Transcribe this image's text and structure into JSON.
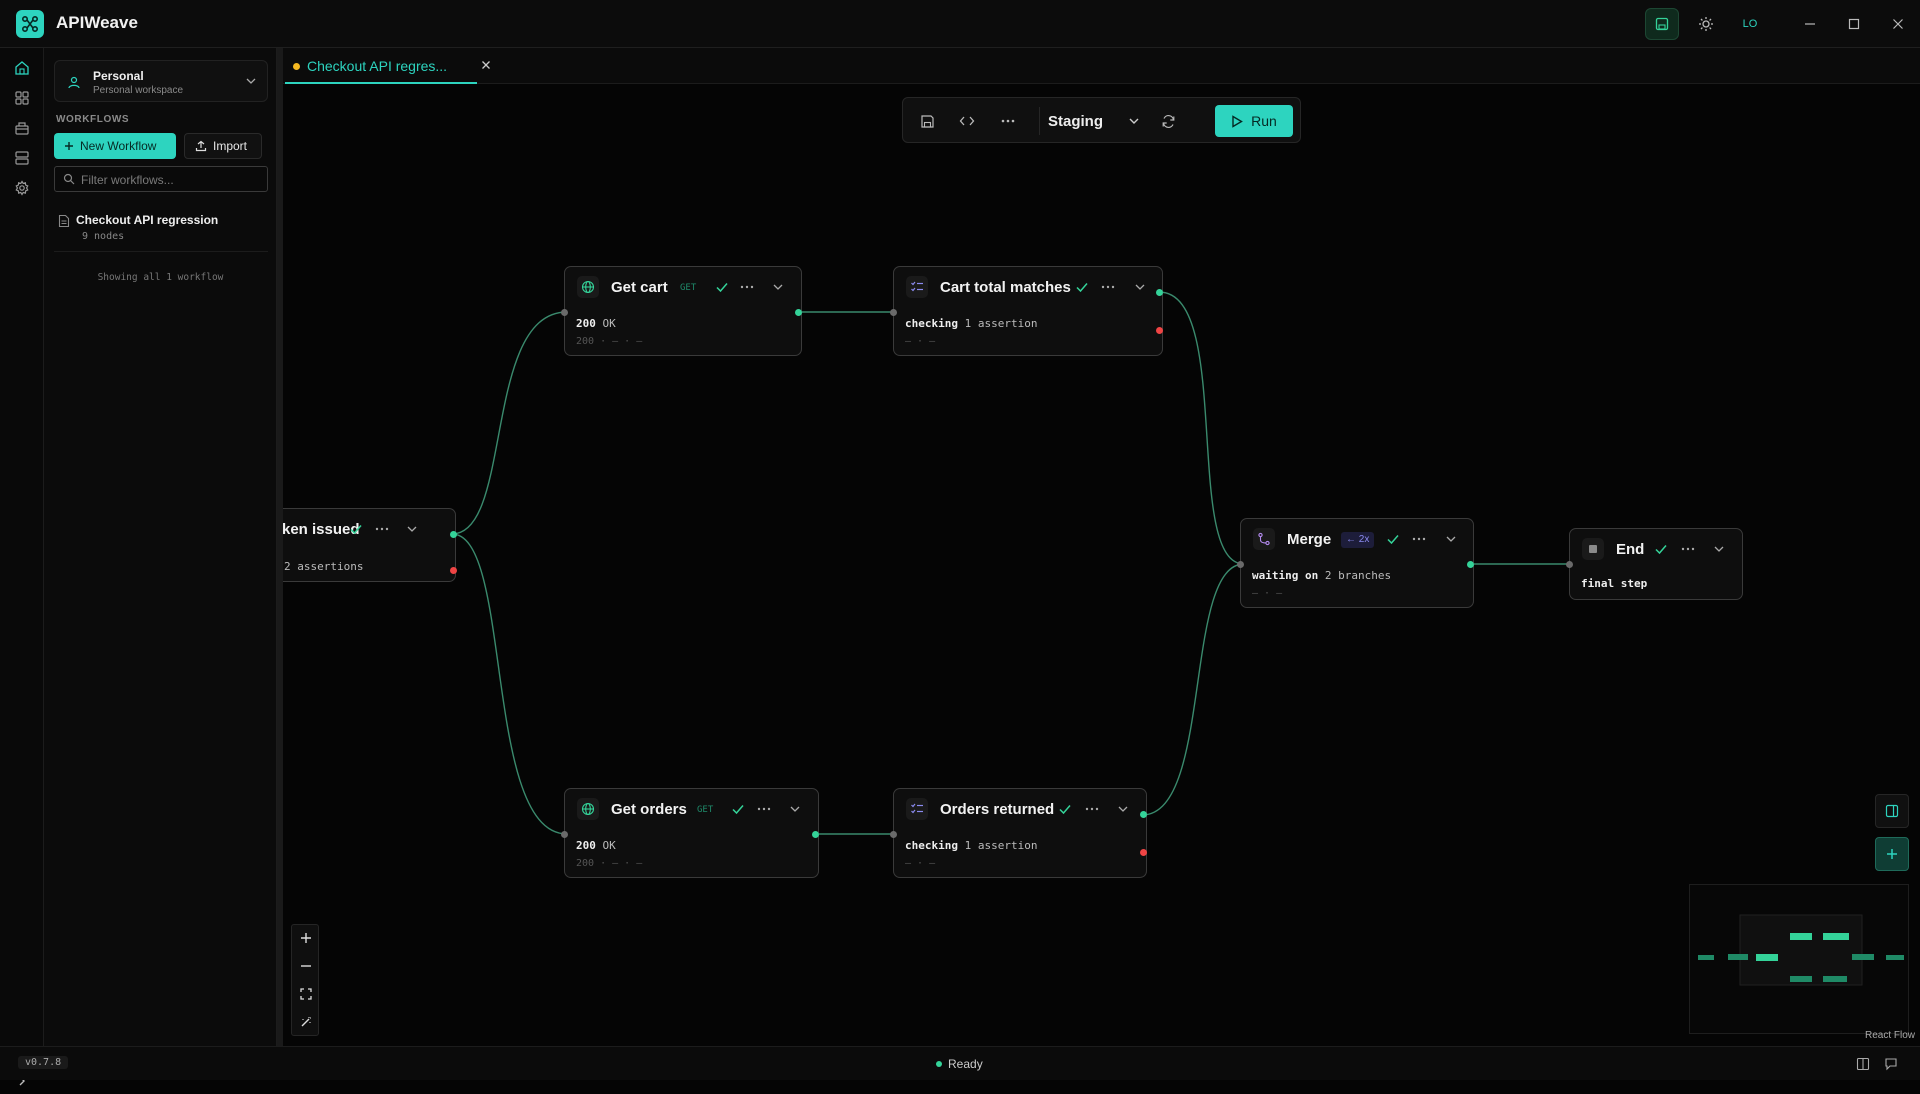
{
  "app": {
    "name": "APIWeave",
    "avatar_initials": "LO",
    "version": "v0.7.8"
  },
  "colors": {
    "accent": "#2dd4bf",
    "success": "#34d399",
    "danger": "#ef4444",
    "warning": "#f5b820",
    "background": "#050505"
  },
  "sidebar": {
    "workspace": {
      "name": "Personal",
      "subtitle": "Personal workspace"
    },
    "section_heading": "WORKFLOWS",
    "new_workflow_label": "New Workflow",
    "import_label": "Import",
    "filter_placeholder": "Filter workflows...",
    "workflows": [
      {
        "title": "Checkout API regression",
        "subtitle": "9 nodes"
      }
    ],
    "count_text": "Showing all 1 workflow"
  },
  "tab": {
    "title": "Checkout API regres..."
  },
  "toolbar": {
    "environment": "Staging",
    "run_label": "Run"
  },
  "nodes": {
    "token": {
      "title": "ken issued",
      "line1": "2 assertions"
    },
    "get_cart": {
      "title": "Get cart",
      "method": "GET",
      "status_code": "200",
      "status_text": "OK",
      "meta": "200 · — · —"
    },
    "cart_total": {
      "title": "Cart total matches",
      "prefix": "checking",
      "detail": "1 assertion",
      "meta": "— · —"
    },
    "get_orders": {
      "title": "Get orders",
      "method": "GET",
      "status_code": "200",
      "status_text": "OK",
      "meta": "200 · — · —"
    },
    "orders_returned": {
      "title": "Orders returned",
      "prefix": "checking",
      "detail": "1 assertion",
      "meta": "— · —"
    },
    "merge": {
      "title": "Merge",
      "badge": "← 2x",
      "prefix": "waiting on",
      "detail": "2 branches",
      "meta": "— · —"
    },
    "end": {
      "title": "End",
      "line1": "final step"
    }
  },
  "attribution": "React Flow",
  "status": {
    "text": "Ready"
  }
}
